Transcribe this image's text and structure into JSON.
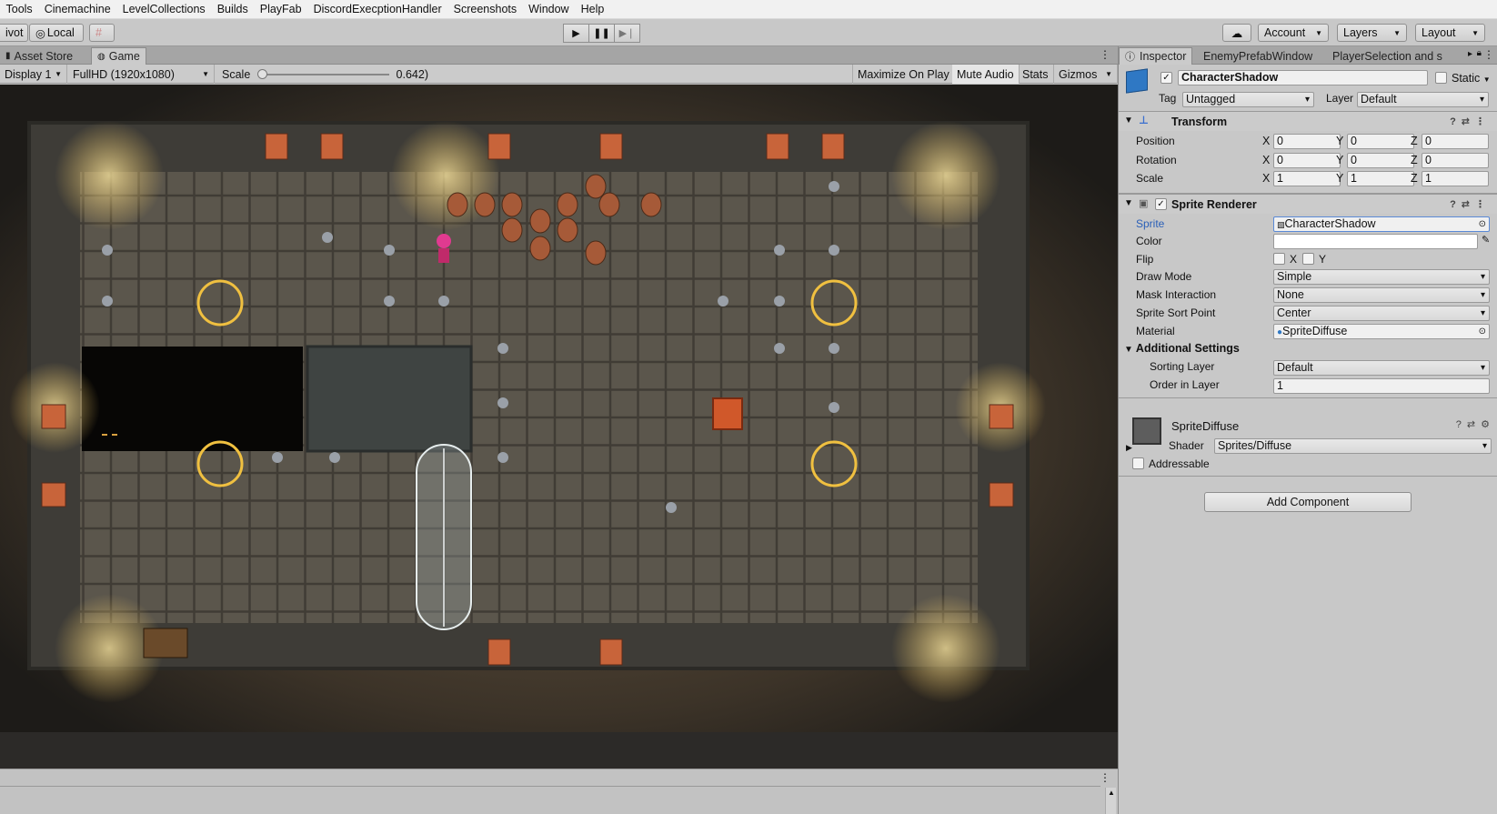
{
  "menu": [
    "Tools",
    "Cinemachine",
    "LevelCollections",
    "Builds",
    "PlayFab",
    "DiscordExecptionHandler",
    "Screenshots",
    "Window",
    "Help"
  ],
  "toolbar": {
    "pivot": "ivot",
    "local": "Local",
    "account": "Account",
    "layers": "Layers",
    "layout": "Layout"
  },
  "game": {
    "tabs": [
      "Asset Store",
      "Game"
    ],
    "display": "Display 1",
    "resolution": "FullHD (1920x1080)",
    "scale_label": "Scale",
    "scale_value": "0.642)",
    "maximize": "Maximize On Play",
    "mute": "Mute Audio",
    "stats": "Stats",
    "gizmos": "Gizmos"
  },
  "inspector": {
    "tabs": [
      "Inspector",
      "EnemyPrefabWindow",
      "PlayerSelection and s"
    ],
    "object_name": "CharacterShadow",
    "static_label": "Static",
    "tag_label": "Tag",
    "tag_value": "Untagged",
    "layer_label": "Layer",
    "layer_value": "Default",
    "transform": {
      "title": "Transform",
      "position_label": "Position",
      "rotation_label": "Rotation",
      "scale_label": "Scale",
      "position": [
        "0",
        "0",
        "0"
      ],
      "rotation": [
        "0",
        "0",
        "0"
      ],
      "scale": [
        "1",
        "1",
        "1"
      ]
    },
    "sprite_renderer": {
      "title": "Sprite Renderer",
      "sprite_label": "Sprite",
      "sprite_value": "CharacterShadow",
      "color_label": "Color",
      "flip_label": "Flip",
      "draw_mode_label": "Draw Mode",
      "draw_mode": "Simple",
      "mask_label": "Mask Interaction",
      "mask": "None",
      "sort_point_label": "Sprite Sort Point",
      "sort_point": "Center",
      "material_label": "Material",
      "material": "SpriteDiffuse",
      "additional_label": "Additional Settings",
      "sorting_layer_label": "Sorting Layer",
      "sorting_layer": "Default",
      "order_label": "Order in Layer",
      "order": "1"
    },
    "material_block": {
      "name": "SpriteDiffuse",
      "shader_label": "Shader",
      "shader": "Sprites/Diffuse"
    },
    "addressable": "Addressable",
    "add_component": "Add Component"
  }
}
